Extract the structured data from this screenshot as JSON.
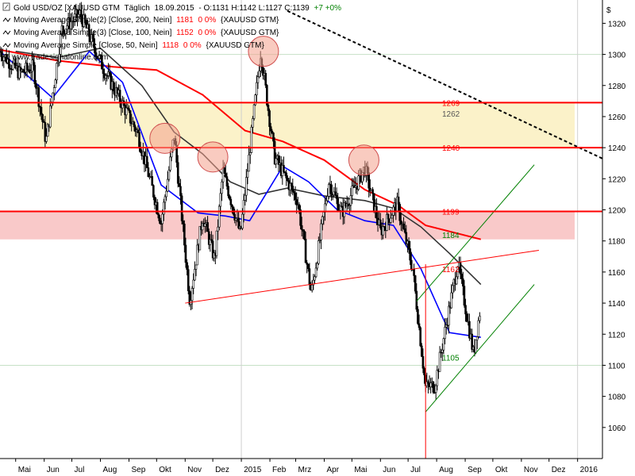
{
  "header": {
    "symbol": "Gold USD/OZ [XAUUSD GTM",
    "period": "Täglich",
    "date": "18.09.2015",
    "ohlc_prefix": "- O:1131 H:1142 L:1127 C:1139",
    "change": "+7 +0%",
    "ma200_label": "Moving Average Simple(2) [Close, 200, Nein]",
    "ma200_value": "1181",
    "ma100_label": "Moving Average Simple(3) [Close, 100, Nein]",
    "ma100_value": "1152",
    "ma50_label": "Moving Average Simple [Close, 50, Nein]",
    "ma50_value": "1118",
    "zero_change": "0 0%",
    "instrument_tag": "{XAUUSD GTM}",
    "watermark": "© www.tradesignalonline.com"
  },
  "axis": {
    "currency": "$",
    "y_ticks": [
      1060,
      1080,
      1100,
      1120,
      1140,
      1160,
      1180,
      1200,
      1220,
      1240,
      1260,
      1280,
      1300,
      1320
    ],
    "x_ticks": [
      "Mai",
      "Jun",
      "Jul",
      "Aug",
      "Sep",
      "Okt",
      "Nov",
      "Dez",
      "2015",
      "Feb",
      "Mrz",
      "Apr",
      "Mai",
      "Jun",
      "Jul",
      "Aug",
      "Sep",
      "Okt",
      "Nov",
      "Dez",
      "2016"
    ]
  },
  "colors": {
    "price": "#000000",
    "ma50": "#0000ff",
    "ma100": "#333333",
    "ma200": "#ff0000",
    "resistance": "#ff0000",
    "channel": "#008000",
    "upper_zone": "#fbf2c9",
    "lower_zone": "#f9c9c9",
    "circle_fill": "#f4a08c",
    "change_green": "#008000"
  },
  "chart_data": {
    "type": "candlestick",
    "ylim": [
      1040,
      1335
    ],
    "xlim": [
      "2014-04-14",
      "2016-01-28"
    ],
    "levels": [
      {
        "value": 1269,
        "label": "1269"
      },
      {
        "value": 1262,
        "label": "1262"
      },
      {
        "value": 1240,
        "label": "1240"
      },
      {
        "value": 1199,
        "label": "1199"
      },
      {
        "value": 1184,
        "label": "1184"
      },
      {
        "value": 1162,
        "label": "1162"
      },
      {
        "value": 1105,
        "label": "1105"
      }
    ],
    "zones": [
      {
        "from": 1240,
        "to": 1269,
        "fill": "upper_zone"
      },
      {
        "from": 1181,
        "to": 1199,
        "fill": "lower_zone"
      }
    ],
    "price_points": [
      [
        "2014-04-14",
        1302
      ],
      [
        "2014-05-05",
        1288
      ],
      [
        "2014-05-20",
        1292
      ],
      [
        "2014-06-03",
        1244
      ],
      [
        "2014-06-20",
        1316
      ],
      [
        "2014-07-10",
        1326
      ],
      [
        "2014-08-05",
        1290
      ],
      [
        "2014-09-10",
        1250
      ],
      [
        "2014-10-06",
        1192
      ],
      [
        "2014-10-20",
        1248
      ],
      [
        "2014-11-06",
        1142
      ],
      [
        "2014-11-20",
        1196
      ],
      [
        "2014-12-03",
        1168
      ],
      [
        "2014-12-12",
        1225
      ],
      [
        "2014-12-31",
        1184
      ],
      [
        "2015-01-22",
        1302
      ],
      [
        "2015-02-06",
        1234
      ],
      [
        "2015-03-03",
        1206
      ],
      [
        "2015-03-18",
        1146
      ],
      [
        "2015-04-06",
        1218
      ],
      [
        "2015-04-20",
        1198
      ],
      [
        "2015-05-15",
        1227
      ],
      [
        "2015-06-01",
        1186
      ],
      [
        "2015-06-19",
        1204
      ],
      [
        "2015-07-06",
        1162
      ],
      [
        "2015-07-20",
        1086
      ],
      [
        "2015-07-30",
        1087
      ],
      [
        "2015-08-24",
        1166
      ],
      [
        "2015-09-10",
        1107
      ],
      [
        "2015-09-18",
        1139
      ]
    ],
    "ma50": [
      [
        "2014-04-14",
        1302
      ],
      [
        "2014-06-10",
        1272
      ],
      [
        "2014-07-20",
        1302
      ],
      [
        "2014-08-25",
        1282
      ],
      [
        "2014-10-06",
        1216
      ],
      [
        "2014-11-15",
        1198
      ],
      [
        "2014-12-15",
        1196
      ],
      [
        "2015-01-10",
        1193
      ],
      [
        "2015-02-15",
        1228
      ],
      [
        "2015-03-15",
        1218
      ],
      [
        "2015-04-15",
        1200
      ],
      [
        "2015-05-15",
        1193
      ],
      [
        "2015-06-15",
        1190
      ],
      [
        "2015-07-15",
        1162
      ],
      [
        "2015-08-15",
        1121
      ],
      [
        "2015-09-18",
        1118
      ]
    ],
    "ma100": [
      [
        "2014-05-01",
        1302
      ],
      [
        "2014-06-15",
        1298
      ],
      [
        "2014-08-01",
        1304
      ],
      [
        "2014-09-15",
        1280
      ],
      [
        "2014-10-20",
        1250
      ],
      [
        "2014-11-20",
        1236
      ],
      [
        "2014-12-20",
        1218
      ],
      [
        "2015-01-20",
        1210
      ],
      [
        "2015-02-20",
        1214
      ],
      [
        "2015-04-01",
        1209
      ],
      [
        "2015-05-15",
        1206
      ],
      [
        "2015-06-15",
        1201
      ],
      [
        "2015-07-15",
        1189
      ],
      [
        "2015-08-15",
        1172
      ],
      [
        "2015-09-18",
        1152
      ]
    ],
    "ma200": [
      [
        "2014-04-14",
        1303
      ],
      [
        "2014-06-15",
        1296
      ],
      [
        "2014-08-15",
        1292
      ],
      [
        "2014-10-01",
        1290
      ],
      [
        "2014-11-20",
        1274
      ],
      [
        "2015-01-05",
        1251
      ],
      [
        "2015-02-15",
        1244
      ],
      [
        "2015-04-01",
        1232
      ],
      [
        "2015-05-15",
        1213
      ],
      [
        "2015-06-20",
        1203
      ],
      [
        "2015-07-20",
        1190
      ],
      [
        "2015-09-18",
        1181
      ]
    ],
    "trendlines": [
      {
        "name": "support",
        "color": "ma200",
        "from": [
          "2014-11-01",
          1140
        ],
        "to": [
          "2015-11-20",
          1174
        ]
      },
      {
        "name": "downtrend",
        "color": "black_dashed",
        "from": [
          "2015-02-20",
          1328
        ],
        "to": [
          "2016-01-28",
          1233
        ]
      },
      {
        "name": "channel-lower",
        "color": "channel",
        "from": [
          "2015-07-20",
          1070
        ],
        "to": [
          "2015-11-15",
          1152
        ]
      },
      {
        "name": "channel-upper",
        "color": "channel",
        "from": [
          "2015-07-10",
          1141
        ],
        "to": [
          "2015-11-15",
          1229
        ]
      },
      {
        "name": "spike-line",
        "color": "ma200",
        "from": [
          "2015-07-20",
          1165
        ],
        "to": [
          "2015-07-20",
          1040
        ]
      }
    ],
    "highlights": [
      {
        "date": "2014-10-10",
        "value": 1246
      },
      {
        "date": "2014-12-01",
        "value": 1234
      },
      {
        "date": "2015-01-25",
        "value": 1302
      },
      {
        "date": "2015-05-14",
        "value": 1232
      }
    ]
  }
}
